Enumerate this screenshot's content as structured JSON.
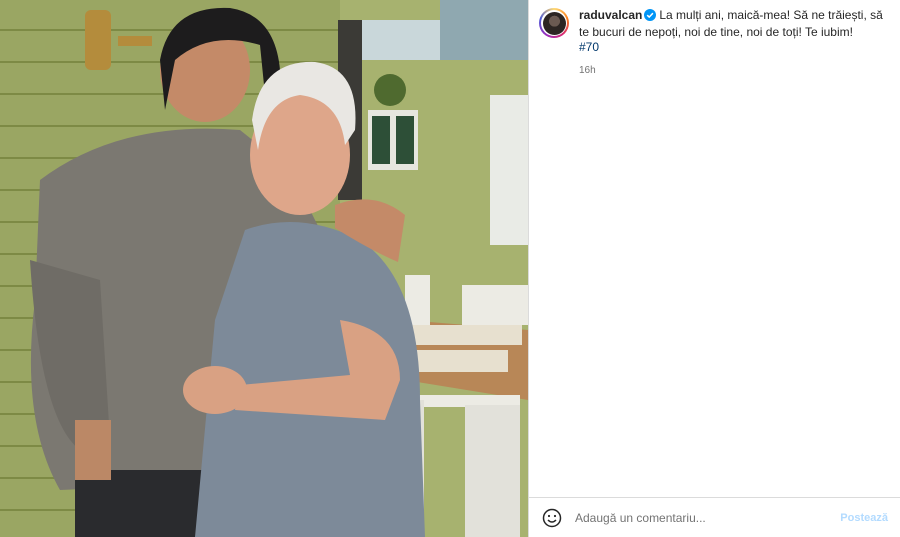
{
  "post": {
    "username": "raduvalcan",
    "caption": "La mulți ani, maică-mea! Să ne trăiești, să te bucuri de nepoți, noi de tine, noi de toți! Te iubim!",
    "hashtag": "#70",
    "time": "16h",
    "verified_color": "#0095f6"
  },
  "comment": {
    "placeholder": "Adaugă un comentariu...",
    "post_label": "Postează"
  },
  "icons": {
    "emoji": "emoji-icon",
    "verified": "verified-badge-icon"
  }
}
